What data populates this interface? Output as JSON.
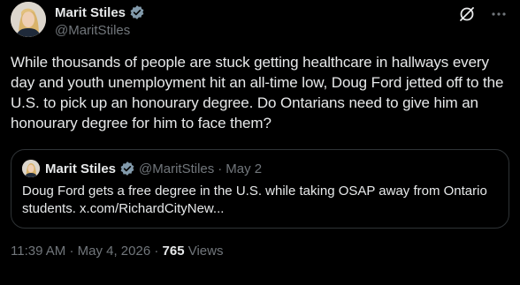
{
  "author": {
    "display_name": "Marit Stiles",
    "handle": "@MaritStiles"
  },
  "tweet": {
    "text": "While thousands of people are stuck getting healthcare in hallways every day and youth unemployment hit an all-time low, Doug Ford jetted off to the U.S. to pick up an honourary degree. Do Ontarians need to give him an honourary degree for him to face them?"
  },
  "quote": {
    "display_name": "Marit Stiles",
    "handle": "@MaritStiles",
    "separator": "·",
    "date": "May 2",
    "text": "Doug Ford gets a free degree in the U.S. while taking OSAP away from Ontario students. x.com/RichardCityNew..."
  },
  "meta": {
    "time": "11:39 AM",
    "sep1": "·",
    "date": "May 4, 2026",
    "sep2": "·",
    "views_count": "765",
    "views_label": "Views"
  },
  "icons": [
    "verified-badge-icon",
    "grok-icon",
    "more-options-icon"
  ],
  "colors": {
    "background": "#000000",
    "text": "#e7e9ea",
    "secondary": "#71767b",
    "border": "#2f3336",
    "verified": "#829aab"
  }
}
